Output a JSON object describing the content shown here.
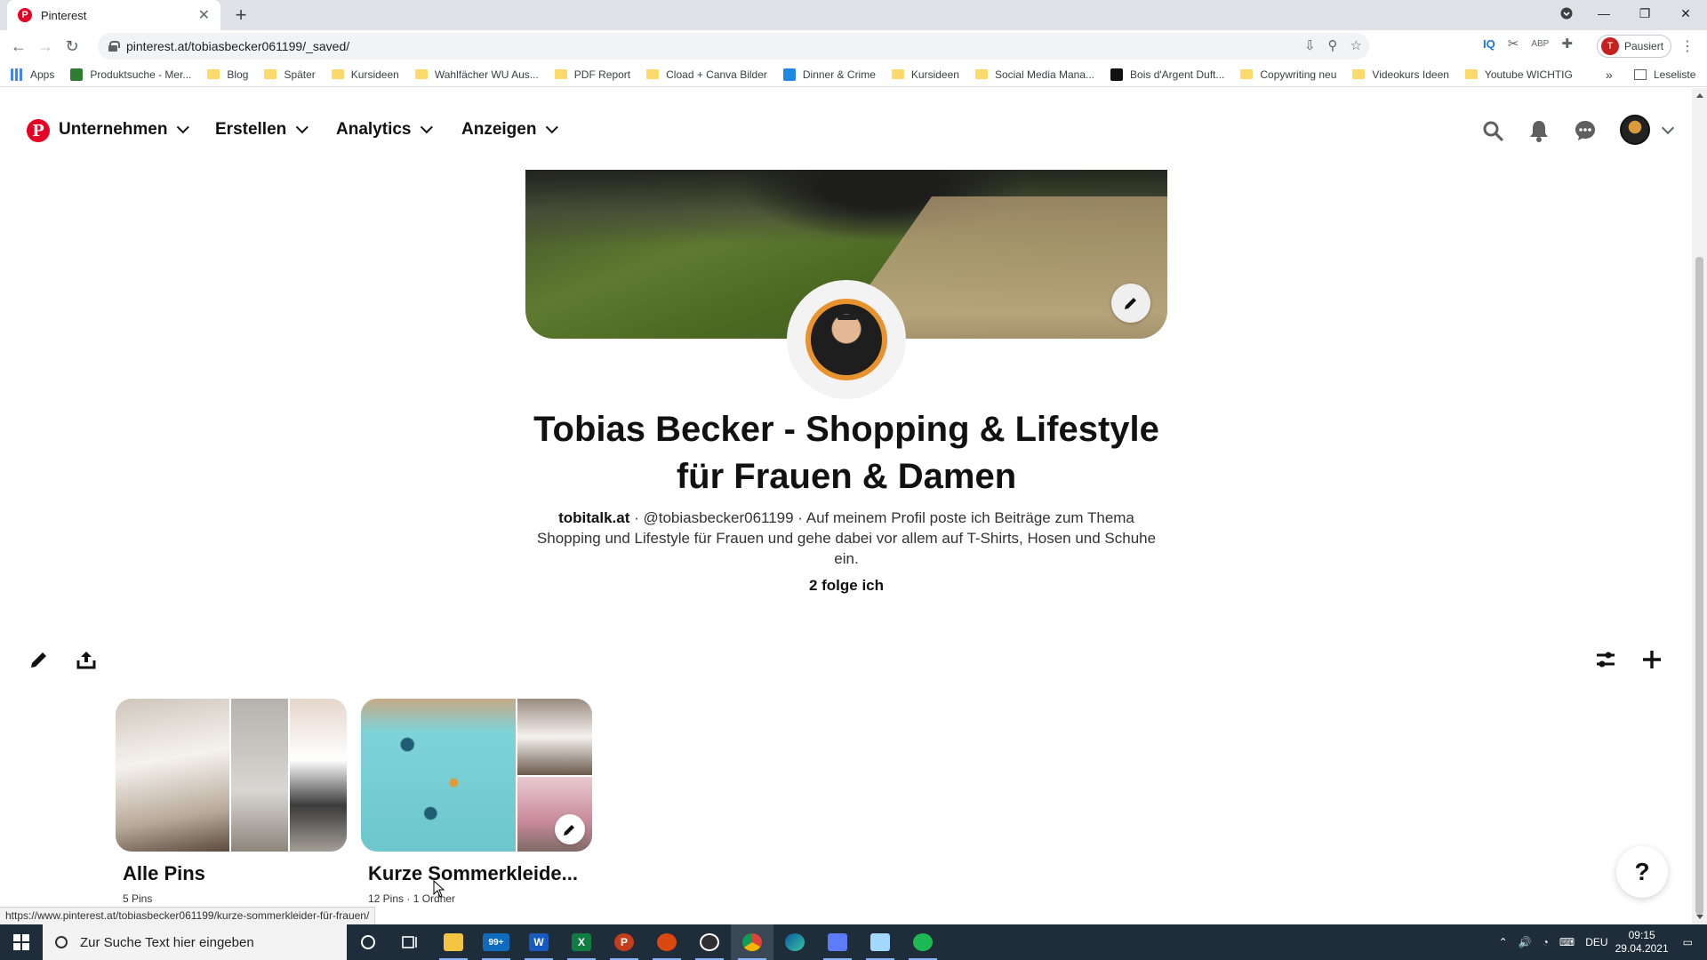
{
  "browser": {
    "tab_title": "Pinterest",
    "url": "pinterest.at/tobiasbecker061199/_saved/",
    "profile_status": "Pausiert",
    "profile_initial": "T",
    "bookmarks": [
      {
        "label": "Apps",
        "kind": "apps"
      },
      {
        "label": "Produktsuche - Mer...",
        "kind": "site",
        "color": "#2e7d32"
      },
      {
        "label": "Blog",
        "kind": "folder"
      },
      {
        "label": "Später",
        "kind": "folder"
      },
      {
        "label": "Kursideen",
        "kind": "folder"
      },
      {
        "label": "Wahlfächer WU Aus...",
        "kind": "folder"
      },
      {
        "label": "PDF Report",
        "kind": "folder"
      },
      {
        "label": "Cload + Canva Bilder",
        "kind": "folder"
      },
      {
        "label": "Dinner & Crime",
        "kind": "site",
        "color": "#1e88e5"
      },
      {
        "label": "Kursideen",
        "kind": "folder"
      },
      {
        "label": "Social Media Mana...",
        "kind": "folder"
      },
      {
        "label": "Bois d'Argent Duft...",
        "kind": "site",
        "color": "#111111"
      },
      {
        "label": "Copywriting neu",
        "kind": "folder"
      },
      {
        "label": "Videokurs Ideen",
        "kind": "folder"
      },
      {
        "label": "Youtube WICHTIG",
        "kind": "folder"
      }
    ],
    "more_bookmarks": "»",
    "reading_list": "Leseliste",
    "status_url": "https://www.pinterest.at/tobiasbecker061199/kurze-sommerkleider-für-frauen/"
  },
  "header": {
    "menus": [
      {
        "label": "Unternehmen"
      },
      {
        "label": "Erstellen"
      },
      {
        "label": "Analytics"
      },
      {
        "label": "Anzeigen"
      }
    ]
  },
  "profile": {
    "name": "Tobias Becker - Shopping & Lifestyle für Frauen & Damen",
    "website": "tobitalk.at",
    "about": " · @tobiasbecker061199 · Auf meinem Profil poste ich Beiträge zum Thema Shopping und Lifestyle für Frauen und gehe dabei vor allem auf T-Shirts, Hosen und Schuhe ein.",
    "following": "2 folge ich"
  },
  "boards": [
    {
      "title": "Alle Pins",
      "meta": "5 Pins"
    },
    {
      "title": "Kurze Sommerkleide...",
      "meta": "12 Pins · 1 Ordner"
    }
  ],
  "help_label": "?",
  "taskbar": {
    "search_placeholder": "Zur Suche Text hier eingeben",
    "mail_badge": "99+",
    "language": "DEU",
    "time": "09:15",
    "date": "29.04.2021"
  },
  "colors": {
    "pinterest_red": "#e60023",
    "taskbar": "#1f2d3a"
  }
}
